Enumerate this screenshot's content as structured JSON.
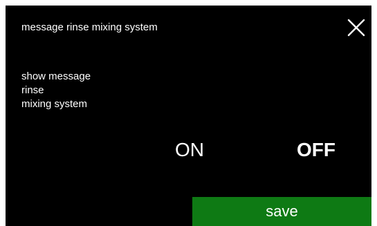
{
  "header": {
    "title": "message rinse mixing system",
    "close_icon": "close-icon"
  },
  "description": {
    "lines": [
      "show message",
      "rinse",
      "mixing system"
    ]
  },
  "options": {
    "on_label": "ON",
    "off_label": "OFF",
    "selected": "OFF"
  },
  "footer": {
    "save_label": "save"
  },
  "colors": {
    "background": "#000000",
    "text": "#ffffff",
    "save_button": "#0e7a14"
  }
}
